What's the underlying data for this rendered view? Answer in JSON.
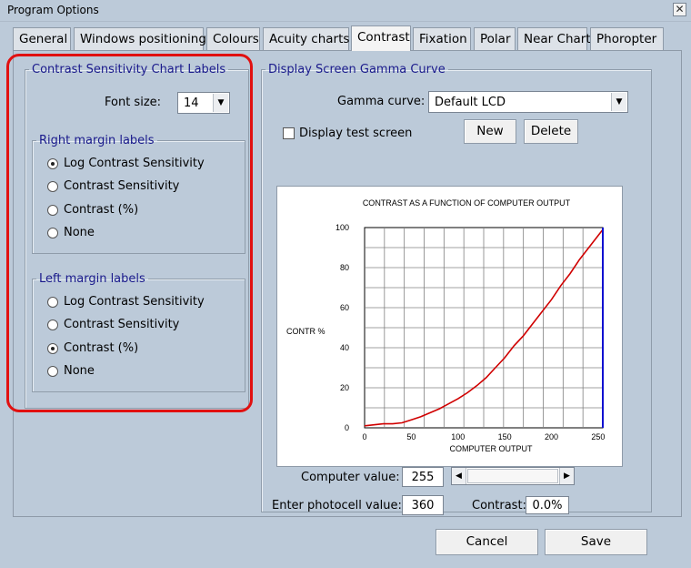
{
  "window": {
    "title": "Program Options",
    "close_glyph": "✕"
  },
  "tabs": [
    {
      "label": "General"
    },
    {
      "label": "Windows positioning"
    },
    {
      "label": "Colours"
    },
    {
      "label": "Acuity charts"
    },
    {
      "label": "Contrast",
      "active": true
    },
    {
      "label": "Fixation"
    },
    {
      "label": "Polar"
    },
    {
      "label": "Near Chart"
    },
    {
      "label": "Phoropter"
    }
  ],
  "labels_group": {
    "title": "Contrast Sensitivity Chart Labels",
    "font_size_label": "Font size:",
    "font_size_value": "14",
    "right": {
      "title": "Right margin labels",
      "options": [
        {
          "label": "Log Contrast Sensitivity",
          "checked": true
        },
        {
          "label": "Contrast Sensitivity",
          "checked": false
        },
        {
          "label": "Contrast (%)",
          "checked": false
        },
        {
          "label": "None",
          "checked": false
        }
      ]
    },
    "left": {
      "title": "Left margin labels",
      "options": [
        {
          "label": "Log Contrast Sensitivity",
          "checked": false
        },
        {
          "label": "Contrast Sensitivity",
          "checked": false
        },
        {
          "label": "Contrast (%)",
          "checked": true
        },
        {
          "label": "None",
          "checked": false
        }
      ]
    }
  },
  "gamma_group": {
    "title": "Display Screen Gamma Curve",
    "gamma_label": "Gamma curve:",
    "gamma_value": "Default LCD",
    "display_test_label": "Display test screen",
    "display_test_checked": false,
    "new_label": "New",
    "delete_label": "Delete",
    "computer_value_label": "Computer value:",
    "computer_value": "255",
    "slider_value": 255,
    "slider_max": 255,
    "photocell_label": "Enter photocell value:",
    "photocell_value": "360",
    "contrast_label": "Contrast:",
    "contrast_value": "0.0%"
  },
  "chart_data": {
    "type": "line",
    "title": "CONTRAST AS A FUNCTION OF COMPUTER OUTPUT",
    "xlabel": "COMPUTER OUTPUT",
    "ylabel": "CONTR %",
    "xlim": [
      0,
      255
    ],
    "ylim": [
      0,
      100
    ],
    "xticks": [
      0,
      50,
      100,
      150,
      200,
      250
    ],
    "yticks": [
      0,
      20,
      40,
      60,
      80,
      100
    ],
    "grid": true,
    "marker_x": 255,
    "series": [
      {
        "color": "#d00000",
        "x": [
          0,
          10,
          20,
          30,
          40,
          50,
          60,
          70,
          80,
          90,
          100,
          110,
          120,
          130,
          140,
          150,
          160,
          170,
          180,
          190,
          200,
          210,
          220,
          230,
          240,
          250,
          255
        ],
        "y": [
          1,
          1.5,
          2,
          2,
          2.5,
          4,
          5.5,
          7.5,
          9.5,
          12,
          14.5,
          17.5,
          21,
          25,
          30,
          35,
          41,
          46,
          52,
          58,
          64,
          71,
          77,
          84,
          90,
          96,
          99
        ]
      }
    ],
    "marker_color": "#1010d0"
  },
  "footer": {
    "cancel_label": "Cancel",
    "save_label": "Save"
  }
}
